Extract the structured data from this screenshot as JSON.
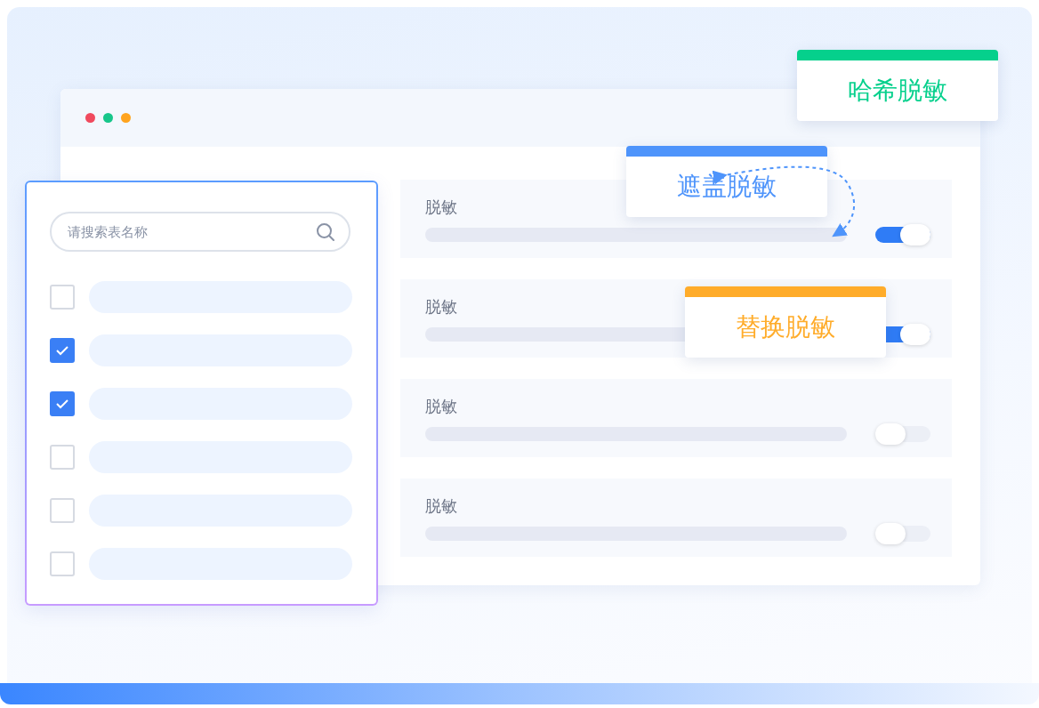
{
  "window": {
    "dots": [
      {
        "color": "#f04a5e"
      },
      {
        "color": "#17c68a"
      },
      {
        "color": "#ffa41f"
      }
    ]
  },
  "rules": [
    {
      "label": "脱敏",
      "on": true
    },
    {
      "label": "脱敏",
      "on": true
    },
    {
      "label": "脱敏",
      "on": false
    },
    {
      "label": "脱敏",
      "on": false
    }
  ],
  "table_picker": {
    "search": {
      "placeholder": "请搜索表名称"
    },
    "items": [
      {
        "checked": false
      },
      {
        "checked": true
      },
      {
        "checked": true
      },
      {
        "checked": false
      },
      {
        "checked": false
      },
      {
        "checked": false
      }
    ]
  },
  "method_cards": [
    {
      "label": "哈希脱敏",
      "color": "#05d08c"
    },
    {
      "label": "遮盖脱敏",
      "color": "#4e94fb"
    },
    {
      "label": "替换脱敏",
      "color": "#ffac2a"
    }
  ]
}
